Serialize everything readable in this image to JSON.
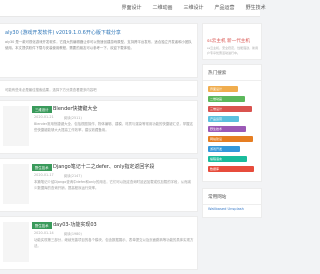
{
  "nav": {
    "items": [
      "界面设计",
      "二维动画",
      "三维设计",
      "产品运营",
      "野生技术"
    ]
  },
  "hero": {
    "title": "aly30 (游戏开发软件) v2019.1.0.6开心版下载分享",
    "text": "aly30 是一款可视化游戏开发软件，它强大的编辑器让你可以快速创建游戏原型，支持跨平台发布，适合独立开发者和小团队使用。本文提供软件下载与安装使用教程，需要的朋友可以参考一下，欢迎下载体验。"
  },
  "notice": {
    "text": "可能有些未必是最佳搜索结果，选择下方分类查看更多内容吧"
  },
  "posts": [
    {
      "category": "三维设计",
      "title": "Blender快捷键大全",
      "date": "2020-01-21",
      "views": "阅读(2511)",
      "excerpt": "Blender常用快捷键大全，包括视图操作、物体编辑、建模、材质与渲染等常用功能的快捷键汇总，掌握这些快捷键能够大大提高工作效率，建议收藏备用。"
    },
    {
      "category": "野生技术",
      "title": "Django笔记十二之defer、only指定返回字段",
      "date": "2020-01-17",
      "views": "阅读(2147)",
      "excerpt": "本篇笔记介绍Django查询中defer和only的用法，它们可以指定查询时延迟加载或仅加载的字段，从而减少数据库的查询开销，提高程序运行效率。"
    },
    {
      "category": "野生技术",
      "title": "day03-功能实现03",
      "date": "2020-01-14",
      "views": "阅读(1980)",
      "excerpt": "功能实现第三部分，继续完善项目的各个模块，包含数据展示、表单提交以及页面跳转等功能的具体实现方法。"
    }
  ],
  "sidebar": {
    "promo": {
      "title": "ss云主机 新一代主机",
      "text": "ss云主机，安全稳定，性能强劲，新用户专享优惠活动进行中。"
    },
    "tags": {
      "title": "热门搜索",
      "items": [
        "界面设计",
        "二维动画",
        "三维设计",
        "产品运营",
        "野生技术",
        "网站建设",
        "游戏开发",
        "编程语言",
        "数据库"
      ]
    },
    "links": {
      "title": "常用网站",
      "item": "Wallbased Unsplash"
    }
  },
  "colors": {
    "tag_palette": [
      "#f0ad4e",
      "#5cb85c",
      "#d9534f",
      "#5bc0de",
      "#9b59b6",
      "#e67e22",
      "#3498db",
      "#1abc9c",
      "#e74c3c"
    ]
  }
}
